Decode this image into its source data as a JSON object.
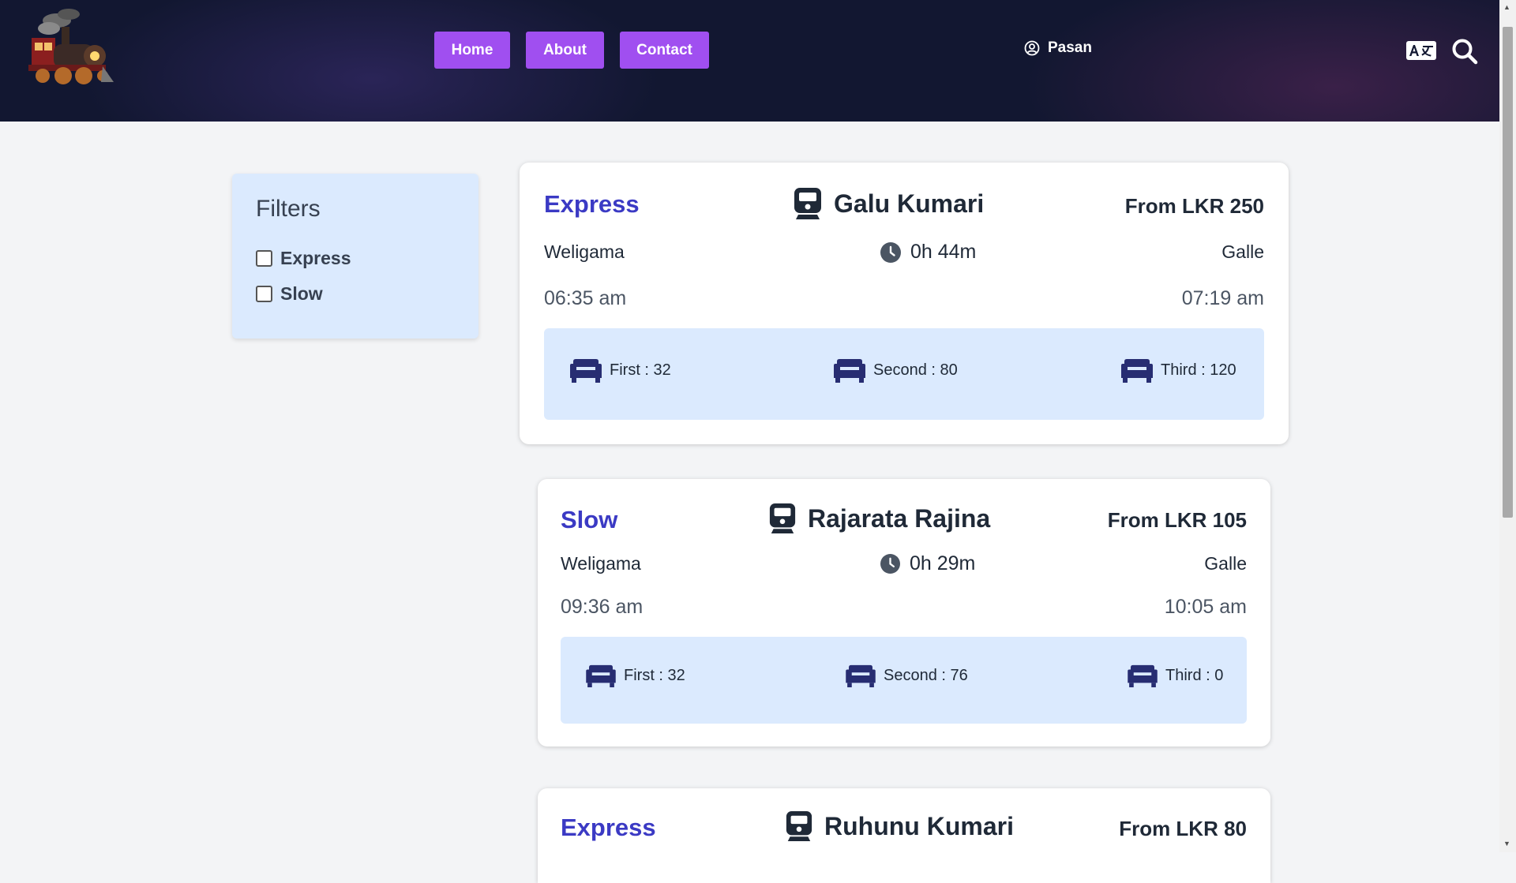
{
  "nav": {
    "home": "Home",
    "about": "About",
    "contact": "Contact",
    "user": "Pasan"
  },
  "filters": {
    "title": "Filters",
    "options": [
      "Express",
      "Slow"
    ]
  },
  "trains": [
    {
      "type": "Express",
      "name": "Galu Kumari",
      "price": "From LKR 250",
      "from": "Weligama",
      "to": "Galle",
      "duration": "0h 44m",
      "depart": "06:35 am",
      "arrive": "07:19 am",
      "seats": [
        "First : 32",
        "Second : 80",
        "Third : 120"
      ]
    },
    {
      "type": "Slow",
      "name": "Rajarata Rajina",
      "price": "From LKR 105",
      "from": "Weligama",
      "to": "Galle",
      "duration": "0h 29m",
      "depart": "09:36 am",
      "arrive": "10:05 am",
      "seats": [
        "First : 32",
        "Second : 76",
        "Third : 0"
      ]
    },
    {
      "type": "Express",
      "name": "Ruhunu Kumari",
      "price": "From LKR 80"
    }
  ],
  "colors": {
    "accent": "#a04ff0",
    "type_text": "#3b3ac4",
    "seat_icon": "#272d72",
    "seat_panel": "#dbeafe",
    "header_bg": "#121731"
  }
}
